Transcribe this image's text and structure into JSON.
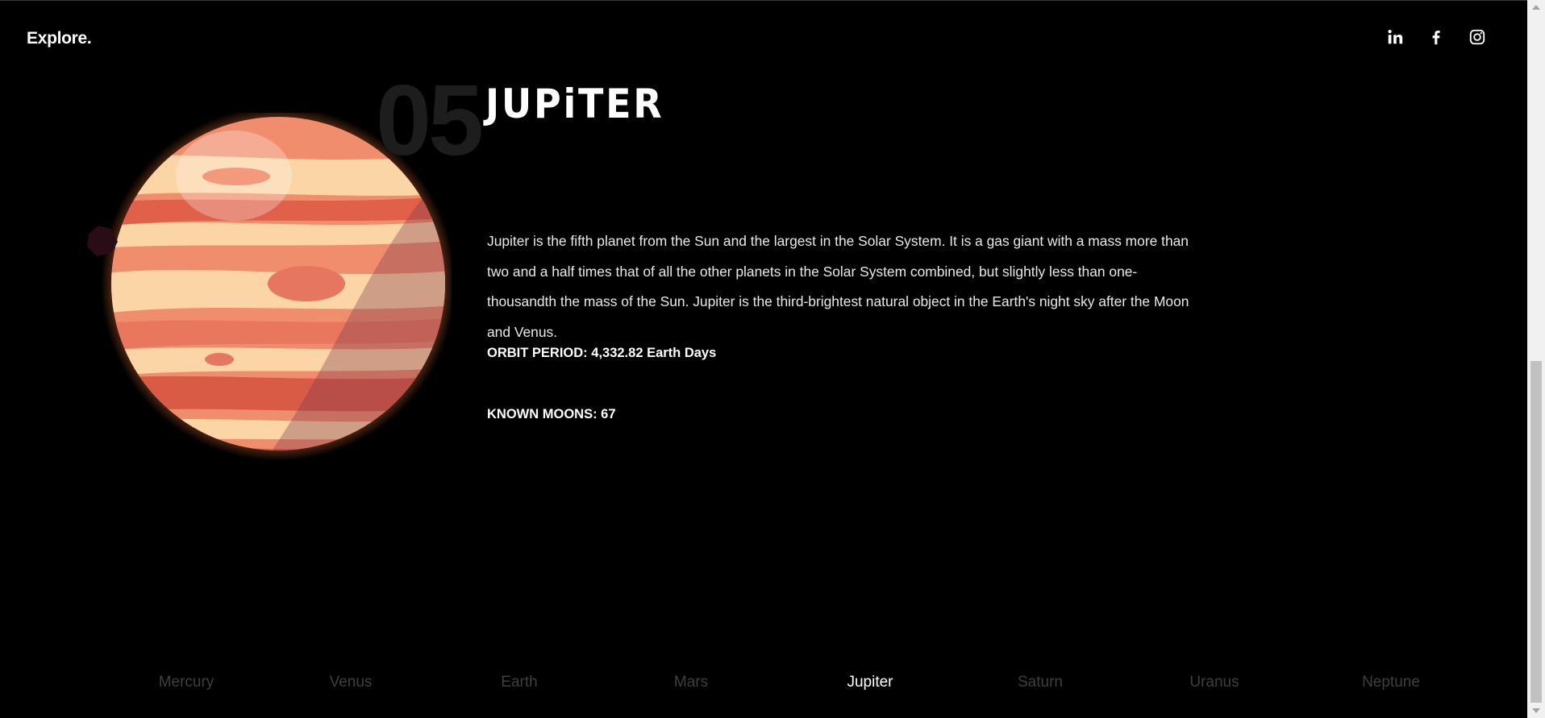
{
  "header": {
    "brand": "Explore.",
    "social": [
      {
        "name": "linkedin-icon"
      },
      {
        "name": "facebook-icon"
      },
      {
        "name": "instagram-icon"
      }
    ]
  },
  "planet": {
    "number": "05",
    "name": "JUPiTER",
    "description": "Jupiter is the fifth planet from the Sun and the largest in the Solar System. It is a gas giant with a mass more than two and a half times that of all the other planets in the Solar System combined, but slightly less than one-thousandth the mass of the Sun. Jupiter is the third-brightest natural object in the Earth's night sky after the Moon and Venus.",
    "orbit_label": "ORBIT PERIOD:",
    "orbit_value": "4,332.82 Earth Days",
    "moons_label": "KNOWN MOONS:",
    "moons_value": "67"
  },
  "nav": {
    "items": [
      {
        "label": "Mercury",
        "active": false
      },
      {
        "label": "Venus",
        "active": false
      },
      {
        "label": "Earth",
        "active": false
      },
      {
        "label": "Mars",
        "active": false
      },
      {
        "label": "Jupiter",
        "active": true
      },
      {
        "label": "Saturn",
        "active": false
      },
      {
        "label": "Uranus",
        "active": false
      },
      {
        "label": "Neptune",
        "active": false
      }
    ]
  },
  "colors": {
    "background": "#000000",
    "inactive_nav": "#3f3f3f",
    "active_nav": "#ffffff",
    "number": "#1d1d1d",
    "planet_base": "#f08d6c",
    "planet_band_light": "#fbd5a6",
    "planet_band_dark": "#d95a45"
  }
}
